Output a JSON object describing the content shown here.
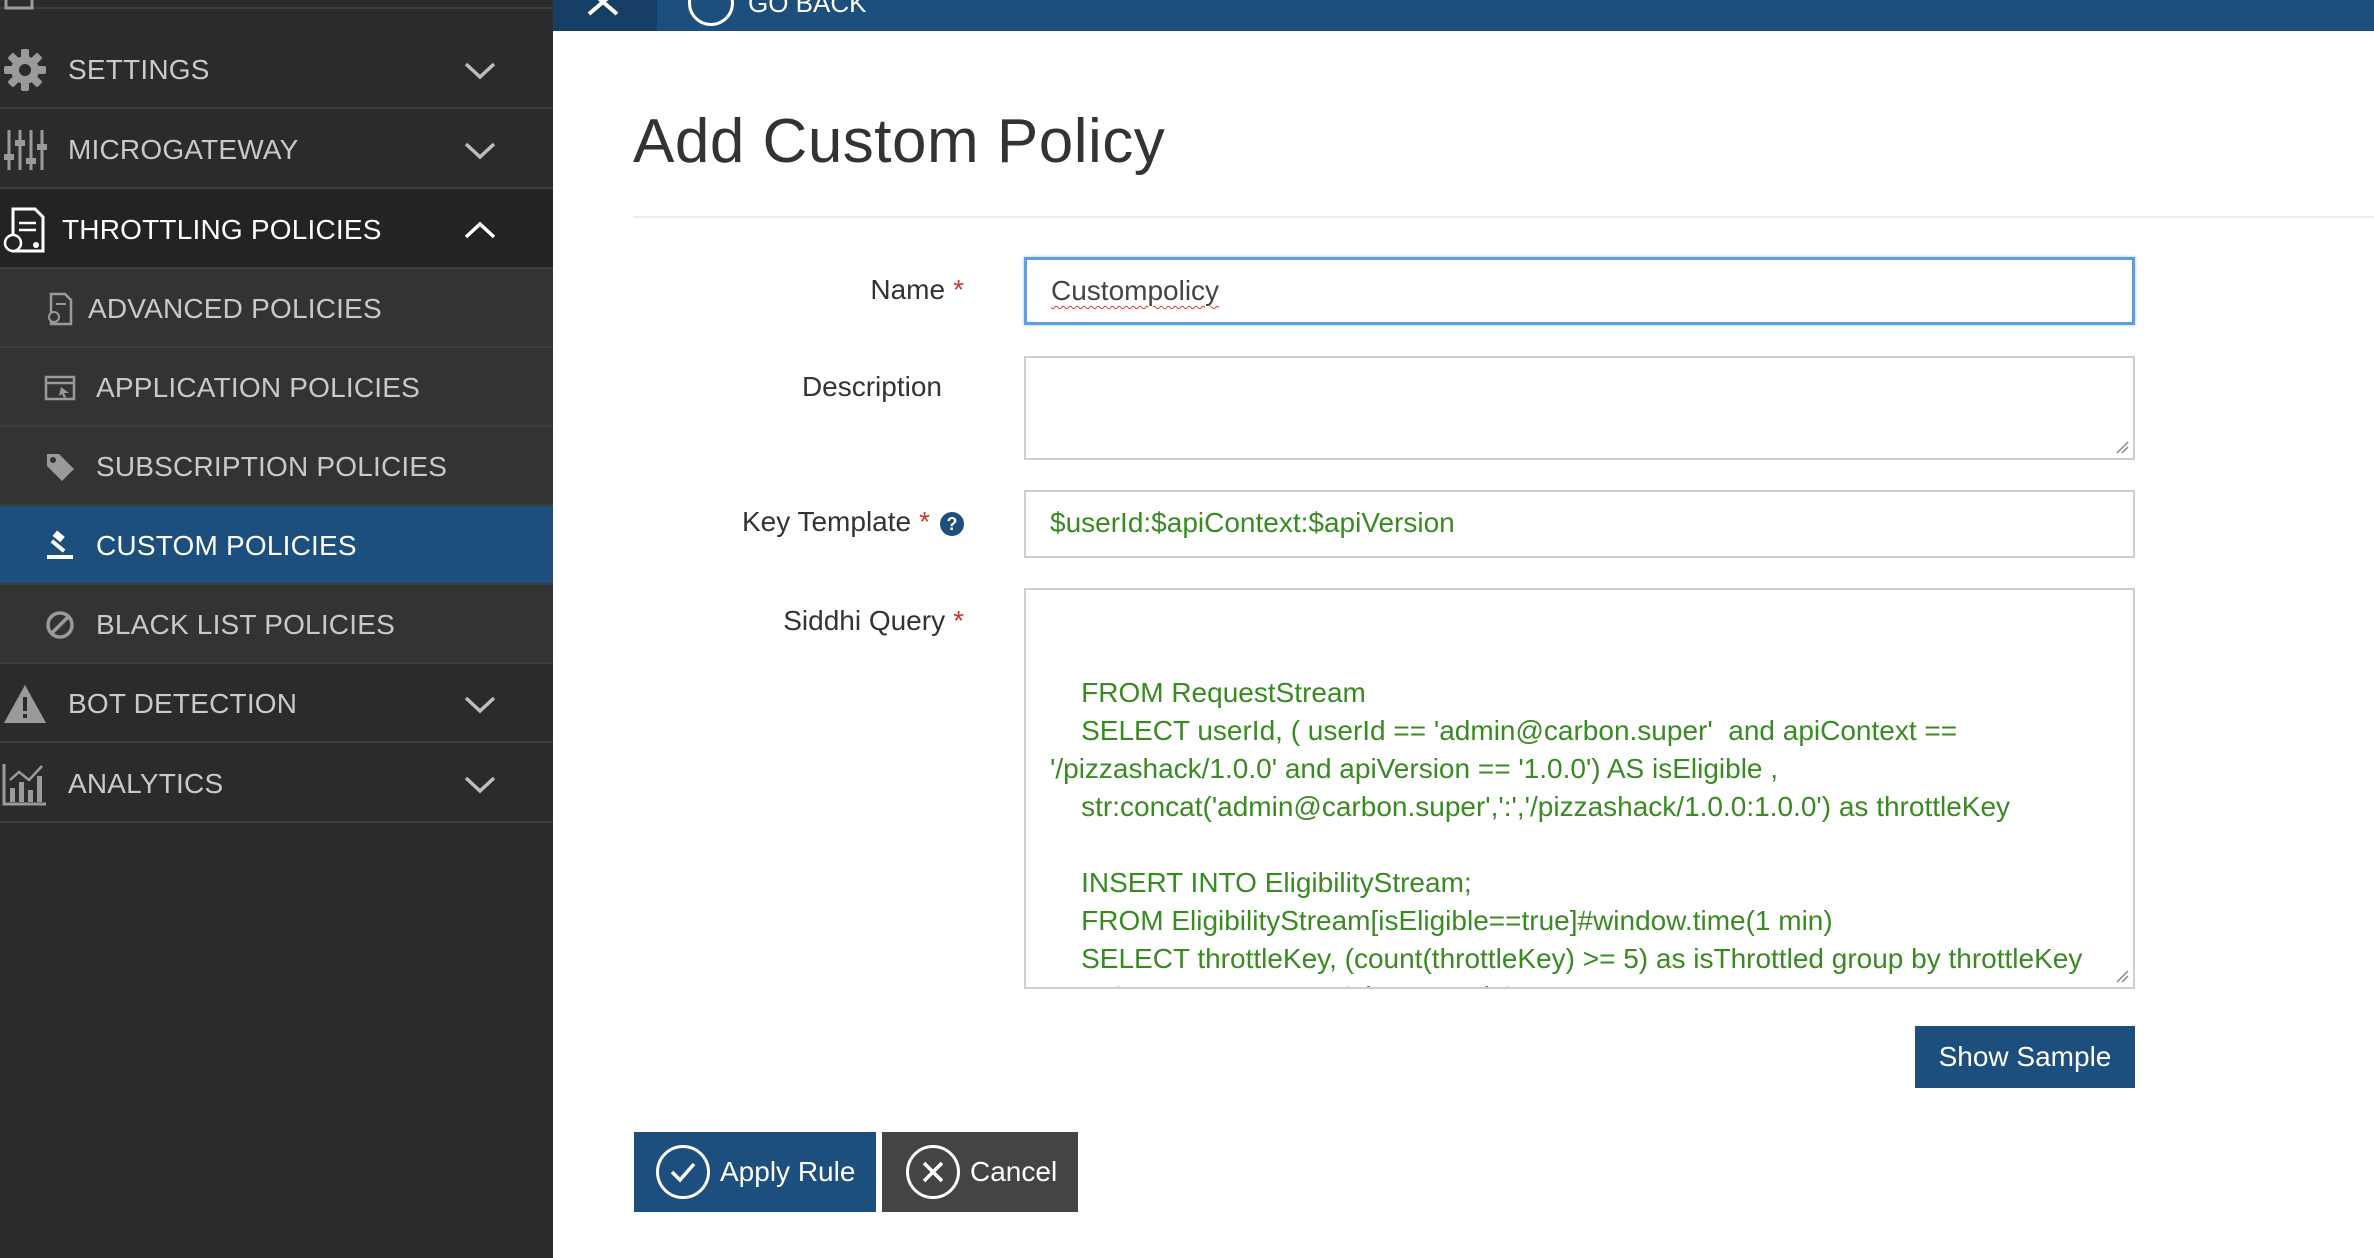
{
  "sidebar": {
    "items": [
      {
        "label": "SETTINGS",
        "icon": "gear-icon"
      },
      {
        "label": "MICROGATEWAY",
        "icon": "sliders-icon"
      },
      {
        "label": "THROTTLING POLICIES",
        "icon": "policy-document-icon",
        "expanded": true
      },
      {
        "label": "ADVANCED POLICIES",
        "icon": "document-settings-icon"
      },
      {
        "label": "APPLICATION POLICIES",
        "icon": "application-window-icon"
      },
      {
        "label": "SUBSCRIPTION POLICIES",
        "icon": "tag-icon"
      },
      {
        "label": "CUSTOM POLICIES",
        "icon": "gavel-icon",
        "active": true
      },
      {
        "label": "BLACK LIST POLICIES",
        "icon": "block-icon"
      },
      {
        "label": "BOT DETECTION",
        "icon": "warning-icon"
      },
      {
        "label": "ANALYTICS",
        "icon": "analytics-chart-icon"
      }
    ]
  },
  "topbar": {
    "back_label": "GO BACK"
  },
  "page": {
    "title": "Add Custom Policy"
  },
  "form": {
    "name_label": "Name",
    "name_value": "Custompolicy",
    "description_label": "Description",
    "description_value": "",
    "key_template_label": "Key Template",
    "key_template_value": "$userId:$apiContext:$apiVersion",
    "siddhi_query_label": "Siddhi Query",
    "siddhi_query_value": "    FROM RequestStream\n    SELECT userId, ( userId == 'admin@carbon.super'  and apiContext ==\n'/pizzashack/1.0.0' and apiVersion == '1.0.0') AS isEligible ,\n    str:concat('admin@carbon.super',':','/pizzashack/1.0.0:1.0.0') as throttleKey\n\n    INSERT INTO EligibilityStream;\n    FROM EligibilityStream[isEligible==true]#window.time(1 min)\n    SELECT throttleKey, (count(throttleKey) >= 5) as isThrottled group by throttleKey\n    INSERT ALL EVENTS into ResultStream;",
    "required_mark": "*",
    "help_mark": "?"
  },
  "buttons": {
    "show_sample": "Show Sample",
    "apply_rule": "Apply Rule",
    "cancel": "Cancel"
  },
  "colors": {
    "sidebar_bg": "#2b2b2b",
    "active_bg": "#1c4e7e",
    "accent": "#1c4e7e",
    "field_text": "#3a8a22",
    "required": "#d0342c"
  }
}
